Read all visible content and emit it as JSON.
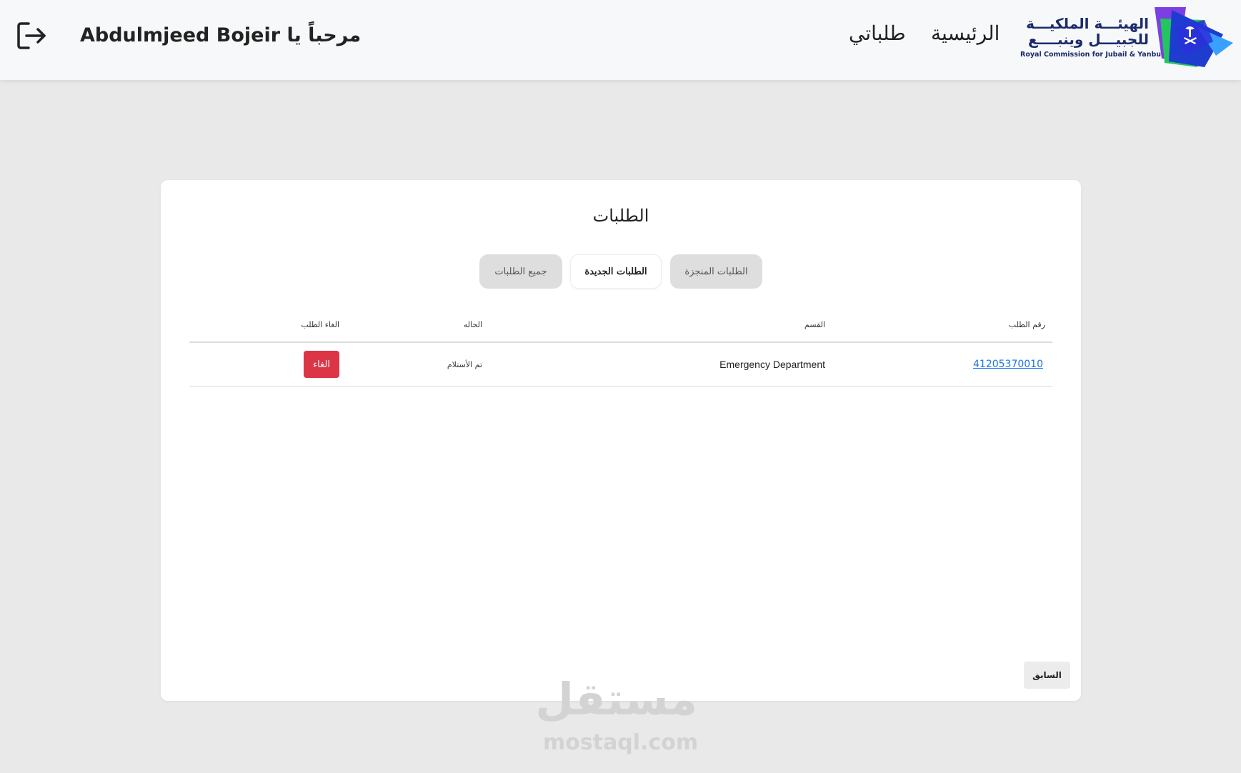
{
  "header": {
    "welcome": "مرحباً يا Abdulmjeed Bojeir",
    "nav": {
      "home": "الرئيسية",
      "my_requests": "طلباتي"
    },
    "logo": {
      "line1": "الهيئـــة الملكيـــة",
      "line2": "للجبيـــل وينبــــع",
      "english": "Royal Commission for Jubail & Yanbu"
    }
  },
  "card": {
    "title": "الطلبات",
    "tabs": {
      "all": "جميع الطلبات",
      "new": "الطلبات الجديدة",
      "done": "الطلبات المنجزة"
    },
    "table": {
      "headers": {
        "request_number": "رقم الطلب",
        "department": "القسم",
        "status": "الحاله",
        "cancel": "الغاء الطلب"
      },
      "rows": [
        {
          "request_number": "41205370010",
          "department": "Emergency Department",
          "status": "تم الأستلام",
          "cancel_label": "الغاء"
        }
      ]
    },
    "previous_button": "السابق"
  },
  "watermark": {
    "arabic": "مستقل",
    "english": "mostaql.com"
  },
  "colors": {
    "background": "#e9e9e9",
    "header_bg": "#f7f8f9",
    "link": "#1a73e8",
    "danger": "#dc3545",
    "logo_navy": "#1b2a6b"
  },
  "icons": {
    "logout": "logout-icon",
    "logo": "royal-commission-logo"
  }
}
